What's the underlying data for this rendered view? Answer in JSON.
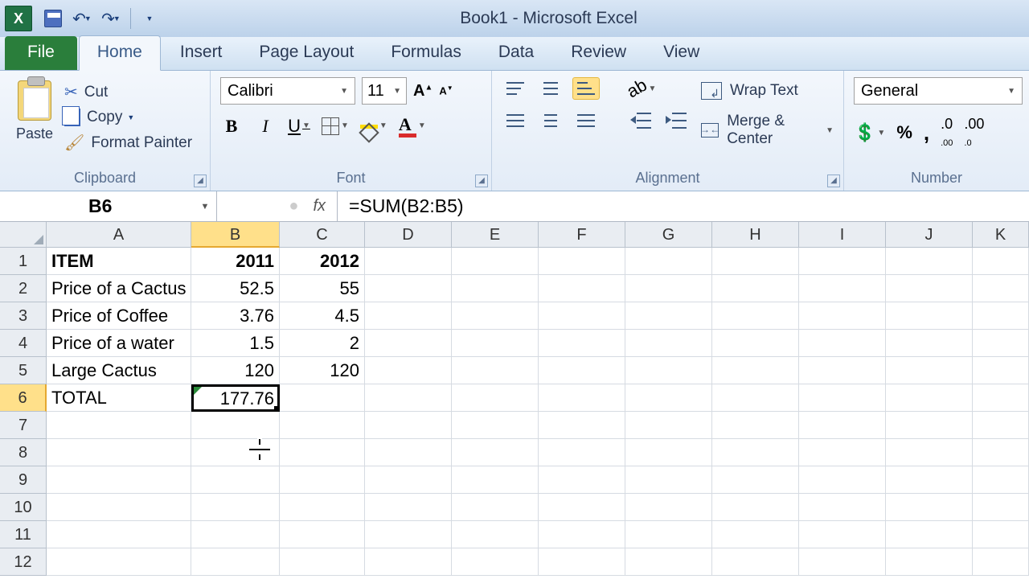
{
  "window": {
    "title": "Book1 - Microsoft Excel"
  },
  "tabs": {
    "file": "File",
    "home": "Home",
    "insert": "Insert",
    "page_layout": "Page Layout",
    "formulas": "Formulas",
    "data": "Data",
    "review": "Review",
    "view": "View"
  },
  "ribbon": {
    "clipboard": {
      "label": "Clipboard",
      "paste": "Paste",
      "cut": "Cut",
      "copy": "Copy",
      "format_painter": "Format Painter"
    },
    "font": {
      "label": "Font",
      "name": "Calibri",
      "size": "11",
      "bold": "B",
      "italic": "I",
      "underline": "U"
    },
    "alignment": {
      "label": "Alignment",
      "wrap": "Wrap Text",
      "merge": "Merge & Center"
    },
    "number": {
      "label": "Number",
      "format": "General",
      "percent": "%",
      "comma": ","
    }
  },
  "namebox": "B6",
  "formula": "=SUM(B2:B5)",
  "columns": [
    "A",
    "B",
    "C",
    "D",
    "E",
    "F",
    "G",
    "H",
    "I",
    "J",
    "K"
  ],
  "row_numbers": [
    "1",
    "2",
    "3",
    "4",
    "5",
    "6",
    "7",
    "8",
    "9",
    "10",
    "11",
    "12"
  ],
  "sheet": {
    "r1": {
      "a": "ITEM",
      "b": "2011",
      "c": "2012"
    },
    "r2": {
      "a": "Price of a Cactus",
      "b": "52.5",
      "c": "55"
    },
    "r3": {
      "a": "Price of Coffee",
      "b": "3.76",
      "c": "4.5"
    },
    "r4": {
      "a": "Price of a water",
      "b": "1.5",
      "c": "2"
    },
    "r5": {
      "a": "Large Cactus",
      "b": "120",
      "c": "120"
    },
    "r6": {
      "a": "TOTAL",
      "b": "177.76",
      "c": ""
    }
  },
  "selected": {
    "col": "B",
    "row": "6"
  },
  "chart_data": {
    "type": "table",
    "columns": [
      "ITEM",
      "2011",
      "2012"
    ],
    "rows": [
      [
        "Price of a Cactus",
        52.5,
        55
      ],
      [
        "Price of Coffee",
        3.76,
        4.5
      ],
      [
        "Price of a water",
        1.5,
        2
      ],
      [
        "Large Cactus",
        120,
        120
      ],
      [
        "TOTAL",
        177.76,
        null
      ]
    ]
  }
}
